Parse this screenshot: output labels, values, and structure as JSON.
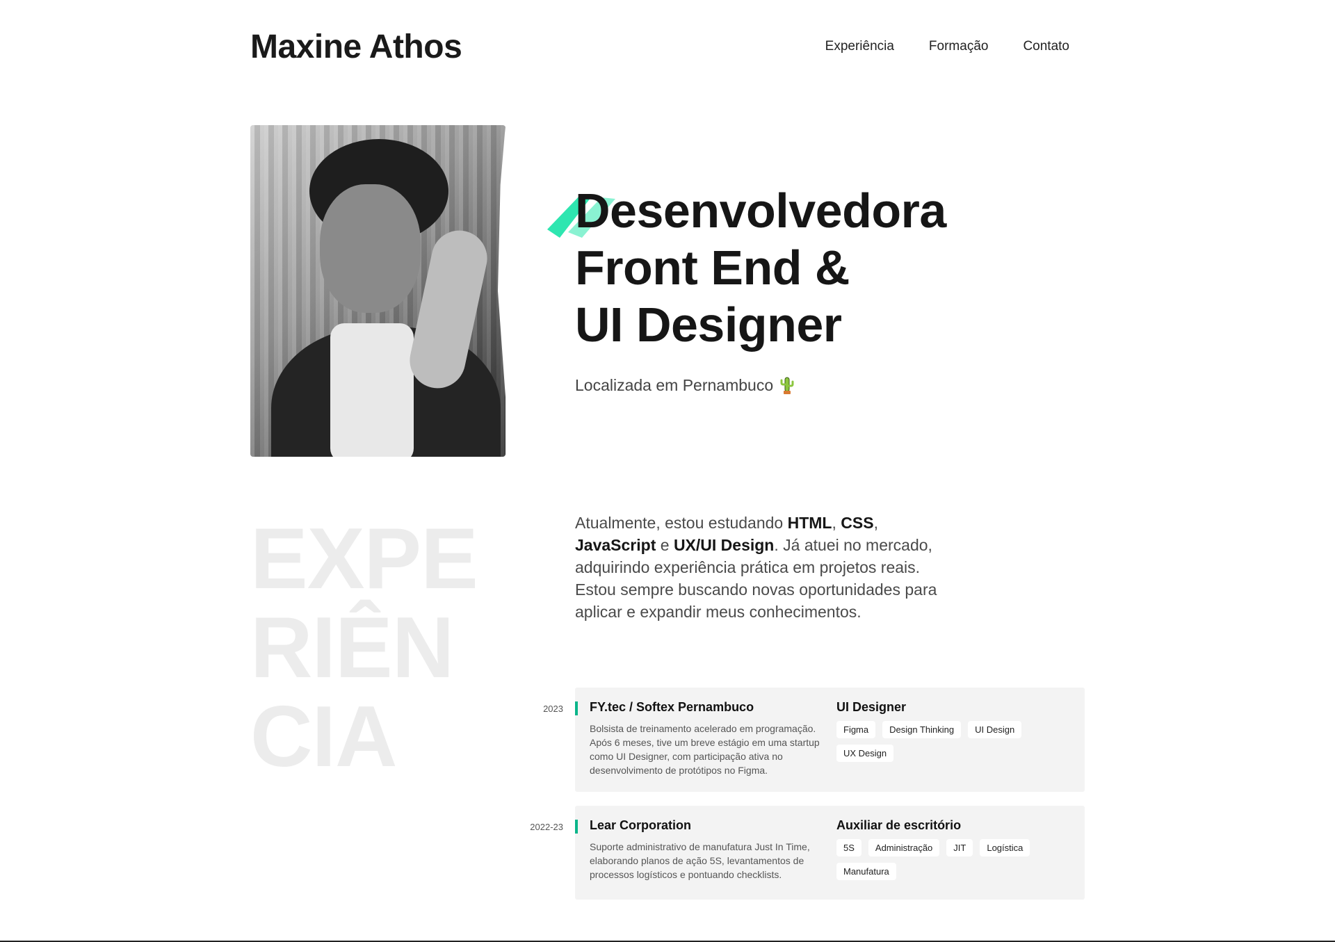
{
  "header": {
    "logo": "Maxine Athos",
    "nav": [
      {
        "label": "Experiência"
      },
      {
        "label": "Formação"
      },
      {
        "label": "Contato"
      }
    ]
  },
  "hero": {
    "title_lines": [
      "Desenvolvedora",
      "Front End &",
      "UI Designer"
    ],
    "location": "Localizada em Pernambuco",
    "location_icon": "cactus-icon",
    "accent_color": "#2ee6b0"
  },
  "experience": {
    "section_word_lines": [
      "EXPE",
      "RIÊN",
      "CIA"
    ],
    "intro": {
      "p1": "Atualmente, estou estudando ",
      "b1": "HTML",
      "p2": ", ",
      "b2": "CSS",
      "p3": ", ",
      "b3": "JavaScript",
      "p4": " e ",
      "b4": "UX/UI Design",
      "p5": ". Já atuei no mercado, adquirindo experiência prática em projetos reais. Estou sempre buscando novas oportunidades para aplicar e expandir meus conhecimentos."
    },
    "items": [
      {
        "year": "2023",
        "company": "FY.tec / Softex Pernambuco",
        "description": "Bolsista de treinamento acelerado em programação. Após 6 meses, tive um breve estágio em uma startup como UI Designer, com participação ativa no desenvolvimento de protótipos no Figma.",
        "role": "UI Designer",
        "tags": [
          "Figma",
          "Design Thinking",
          "UI Design",
          "UX Design"
        ]
      },
      {
        "year": "2022-23",
        "company": "Lear Corporation",
        "description": "Suporte administrativo de manufatura Just In Time, elaborando planos de ação 5S, levantamentos de processos logísticos e pontuando checklists.",
        "role": "Auxiliar de escritório",
        "tags": [
          "5S",
          "Administração",
          "JIT",
          "Logística",
          "Manufatura"
        ]
      }
    ]
  }
}
